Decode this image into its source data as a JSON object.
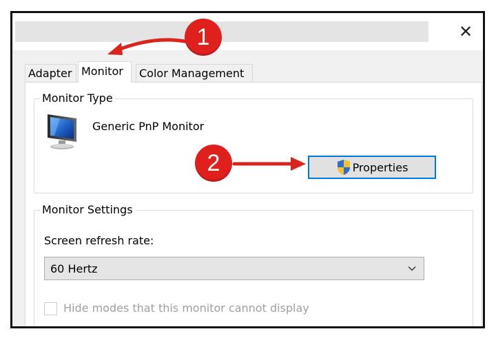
{
  "window": {
    "close_glyph": "✕"
  },
  "tabs": [
    {
      "label": "Adapter"
    },
    {
      "label": "Monitor"
    },
    {
      "label": "Color Management"
    }
  ],
  "monitor_type": {
    "legend": "Monitor Type",
    "monitor_name": "Generic PnP Monitor",
    "properties_label": "Properties"
  },
  "monitor_settings": {
    "legend": "Monitor Settings",
    "refresh_label": "Screen refresh rate:",
    "refresh_value": "60 Hertz",
    "hide_modes_label": "Hide modes that this monitor cannot display",
    "hide_modes_checked": false
  },
  "annotations": [
    {
      "number": "1"
    },
    {
      "number": "2"
    }
  ],
  "colors": {
    "accent": "#0078d7",
    "annotation_red": "#e0201d"
  }
}
